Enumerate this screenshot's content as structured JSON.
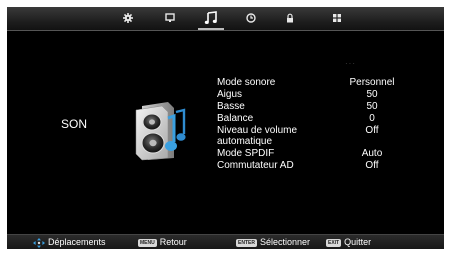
{
  "tabs": [
    {
      "icon": "gear-icon",
      "active": false
    },
    {
      "icon": "monitor-icon",
      "active": false
    },
    {
      "icon": "music-note-icon",
      "active": true
    },
    {
      "icon": "clock-icon",
      "active": false
    },
    {
      "icon": "lock-icon",
      "active": false
    },
    {
      "icon": "grid-icon",
      "active": false
    }
  ],
  "section_title": "SON",
  "menu": [
    {
      "label": "Mode sonore",
      "value": "Personnel"
    },
    {
      "label": "Aigus",
      "value": "50"
    },
    {
      "label": "Basse",
      "value": "50"
    },
    {
      "label": "Balance",
      "value": "0"
    },
    {
      "label": "Niveau de volume automatique",
      "value": "Off"
    },
    {
      "label": "Mode SPDIF",
      "value": "Auto"
    },
    {
      "label": "Commutateur AD",
      "value": "Off"
    }
  ],
  "footer": {
    "move_label": "Déplacements",
    "menu_key": "MENU",
    "back_label": "Retour",
    "enter_key": "ENTER",
    "select_label": "Sélectionner",
    "exit_key": "EXIT",
    "quit_label": "Quitter"
  },
  "colors": {
    "accent": "#3aa0e0",
    "background": "#000000",
    "text": "#ffffff"
  }
}
